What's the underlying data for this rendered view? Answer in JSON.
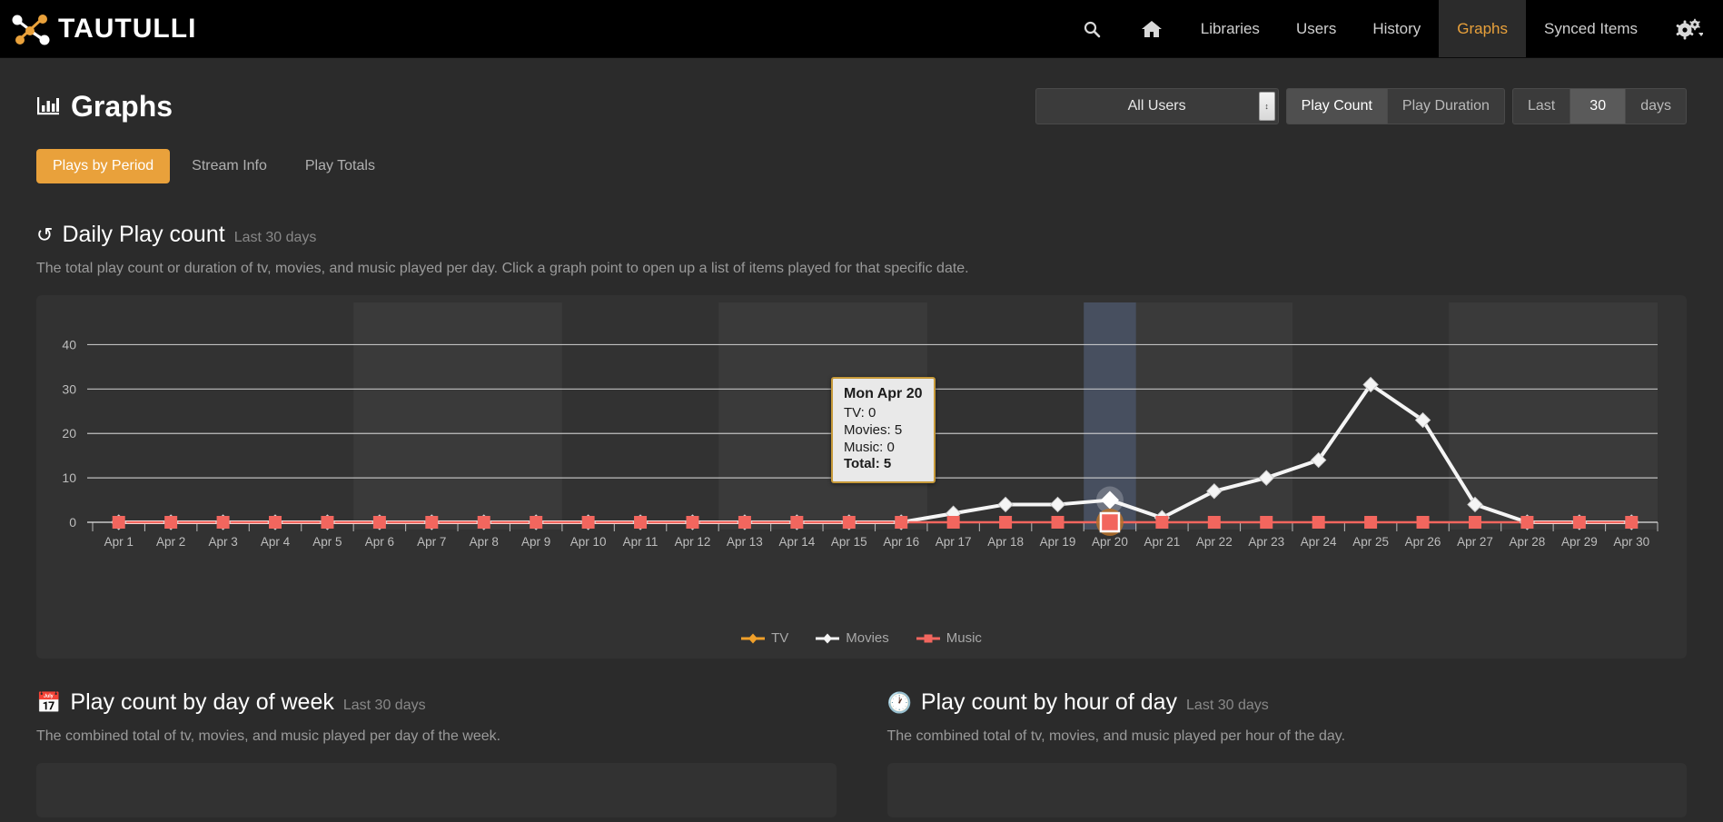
{
  "navbar": {
    "brand": "TAUTULLI",
    "brand_icon": "tautulli-logo-icon",
    "search_icon": "search-icon",
    "home_icon": "home-icon",
    "items": [
      {
        "label": "Libraries",
        "active": false
      },
      {
        "label": "Users",
        "active": false
      },
      {
        "label": "History",
        "active": false
      },
      {
        "label": "Graphs",
        "active": true
      },
      {
        "label": "Synced Items",
        "active": false
      }
    ],
    "settings_icon": "gear-icon",
    "caret_icon": "chevron-down-icon"
  },
  "header": {
    "title": "Graphs",
    "title_icon": "bar-chart-icon",
    "user_select": {
      "value": "All Users",
      "caret_icon": "spinner-updown-icon"
    },
    "metric_buttons": [
      {
        "label": "Play Count",
        "selected": true
      },
      {
        "label": "Play Duration",
        "selected": false
      }
    ],
    "range": {
      "last_label": "Last",
      "days_value": "30",
      "days_label": "days"
    }
  },
  "subtabs": [
    {
      "label": "Plays by Period",
      "active": true
    },
    {
      "label": "Stream Info",
      "active": false
    },
    {
      "label": "Play Totals",
      "active": false
    }
  ],
  "daily": {
    "icon": "history-clock-icon",
    "title": "Daily Play count",
    "subtitle": "Last 30 days",
    "description": "The total play count or duration of tv, movies, and music played per day. Click a graph point to open up a list of items played for that specific date."
  },
  "tooltip": {
    "title": "Mon Apr 20",
    "tv": "TV: 0",
    "movies": "Movies: 5",
    "music": "Music: 0",
    "total": "Total: 5"
  },
  "legend": [
    {
      "label": "TV",
      "color": "#f0a02a",
      "marker": "diamond"
    },
    {
      "label": "Movies",
      "color": "#f5f5f5",
      "marker": "diamond"
    },
    {
      "label": "Music",
      "color": "#f2665e",
      "marker": "square"
    }
  ],
  "bottom": [
    {
      "icon": "calendar-icon",
      "title": "Play count by day of week",
      "subtitle": "Last 30 days",
      "description": "The combined total of tv, movies, and music played per day of the week."
    },
    {
      "icon": "clock-icon",
      "title": "Play count by hour of day",
      "subtitle": "Last 30 days",
      "description": "The combined total of tv, movies, and music played per hour of the day."
    }
  ],
  "colors": {
    "accent": "#e9a13b",
    "tv": "#f0a02a",
    "movies": "#f5f5f5",
    "music": "#f2665e",
    "navbar_bg": "#000000",
    "page_bg": "#2b2b2b",
    "card_bg": "#323232",
    "highlight_band": "#4a5466"
  },
  "chart_data": {
    "type": "line",
    "title": "Daily Play count",
    "xlabel": "",
    "ylabel": "",
    "ylim": [
      0,
      45
    ],
    "yticks": [
      0,
      10,
      20,
      30,
      40
    ],
    "grid": true,
    "legend_position": "bottom",
    "hovered_category": "Apr 20",
    "categories": [
      "Apr 1",
      "Apr 2",
      "Apr 3",
      "Apr 4",
      "Apr 5",
      "Apr 6",
      "Apr 7",
      "Apr 8",
      "Apr 9",
      "Apr 10",
      "Apr 11",
      "Apr 12",
      "Apr 13",
      "Apr 14",
      "Apr 15",
      "Apr 16",
      "Apr 17",
      "Apr 18",
      "Apr 19",
      "Apr 20",
      "Apr 21",
      "Apr 22",
      "Apr 23",
      "Apr 24",
      "Apr 25",
      "Apr 26",
      "Apr 27",
      "Apr 28",
      "Apr 29",
      "Apr 30"
    ],
    "series": [
      {
        "name": "TV",
        "color": "#f0a02a",
        "values": [
          0,
          0,
          0,
          0,
          0,
          0,
          0,
          0,
          0,
          0,
          0,
          0,
          0,
          0,
          0,
          0,
          0,
          0,
          0,
          0,
          0,
          0,
          0,
          0,
          0,
          0,
          0,
          0,
          0,
          0
        ]
      },
      {
        "name": "Movies",
        "color": "#f5f5f5",
        "values": [
          0,
          0,
          0,
          0,
          0,
          0,
          0,
          0,
          0,
          0,
          0,
          0,
          0,
          0,
          0,
          0,
          2,
          4,
          4,
          5,
          1,
          7,
          10,
          14,
          31,
          23,
          4,
          0,
          0,
          0
        ]
      },
      {
        "name": "Music",
        "color": "#f2665e",
        "values": [
          0,
          0,
          0,
          0,
          0,
          0,
          0,
          0,
          0,
          0,
          0,
          0,
          0,
          0,
          0,
          0,
          0,
          0,
          0,
          0,
          0,
          0,
          0,
          0,
          0,
          0,
          0,
          0,
          0,
          0
        ]
      }
    ]
  }
}
